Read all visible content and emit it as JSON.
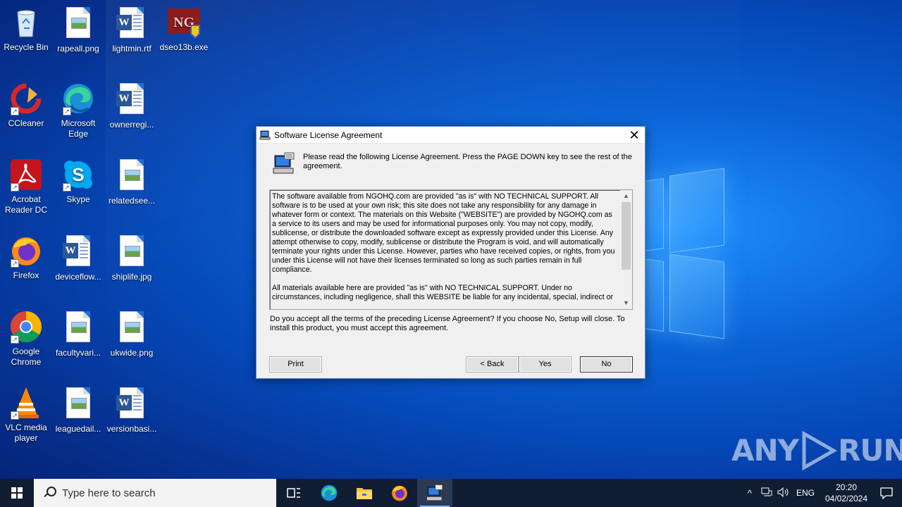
{
  "desktop": {
    "icons": [
      {
        "label": "Recycle Bin",
        "icon": "recycle-bin-icon"
      },
      {
        "label": "rapeall.png",
        "icon": "image-file-icon"
      },
      {
        "label": "lightmin.rtf",
        "icon": "word-doc-icon"
      },
      {
        "label": "dseo13b.exe",
        "icon": "installer-exe-icon"
      },
      {
        "label": "CCleaner",
        "icon": "ccleaner-icon"
      },
      {
        "label": "Microsoft Edge",
        "icon": "edge-icon"
      },
      {
        "label": "ownerregi...",
        "icon": "word-doc-icon"
      },
      {
        "label": "Acrobat Reader DC",
        "icon": "acrobat-icon"
      },
      {
        "label": "Skype",
        "icon": "skype-icon"
      },
      {
        "label": "relatedsee...",
        "icon": "image-file-icon"
      },
      {
        "label": "Firefox",
        "icon": "firefox-icon"
      },
      {
        "label": "deviceflow...",
        "icon": "word-doc-icon"
      },
      {
        "label": "shiplife.jpg",
        "icon": "image-file-icon"
      },
      {
        "label": "Google Chrome",
        "icon": "chrome-icon"
      },
      {
        "label": "facultyvari...",
        "icon": "image-file-icon"
      },
      {
        "label": "ukwide.png",
        "icon": "image-file-icon"
      },
      {
        "label": "VLC media player",
        "icon": "vlc-icon"
      },
      {
        "label": "leaguedail...",
        "icon": "image-file-icon"
      },
      {
        "label": "versionbasi...",
        "icon": "word-doc-icon"
      }
    ]
  },
  "dialog": {
    "title": "Software License Agreement",
    "intro": "Please read the following License Agreement. Press the PAGE DOWN key to see the rest of the agreement.",
    "license_paragraphs": [
      "The software available from NGOHQ.com are provided \"as is\" with NO TECHNICAL SUPPORT. All software is to be used at your own risk; this site does not take any responsibility for any damage in whatever form or context. The materials on this Website (\"WEBSITE\") are provided by NGOHQ.com as a service to its users and may be used for informational purposes only. You may not copy, modify, sublicense, or distribute the downloaded software except as expressly provided under this License. Any attempt otherwise to copy, modify, sublicense or distribute the Program is void, and will automatically terminate your rights under this License. However, parties who have received copies, or rights, from you under this License will not have their licenses terminated so long as such parties remain in full compliance.",
      "All materials available here are provided \"as is\" with NO TECHNICAL SUPPORT. Under no circumstances, including negligence, shall this WEBSITE be liable for any incidental, special, indirect or"
    ],
    "question": "Do you accept all the terms of the preceding License Agreement? If you choose No, Setup will close. To install this product, you must accept this agreement.",
    "buttons": {
      "print": "Print",
      "back": "< Back",
      "yes": "Yes",
      "no": "No"
    },
    "close": "✕"
  },
  "taskbar": {
    "search_placeholder": "Type here to search",
    "lang": "ENG",
    "time": "20:20",
    "date": "04/02/2024"
  },
  "watermark": {
    "left": "ANY",
    "right": "RUN"
  }
}
